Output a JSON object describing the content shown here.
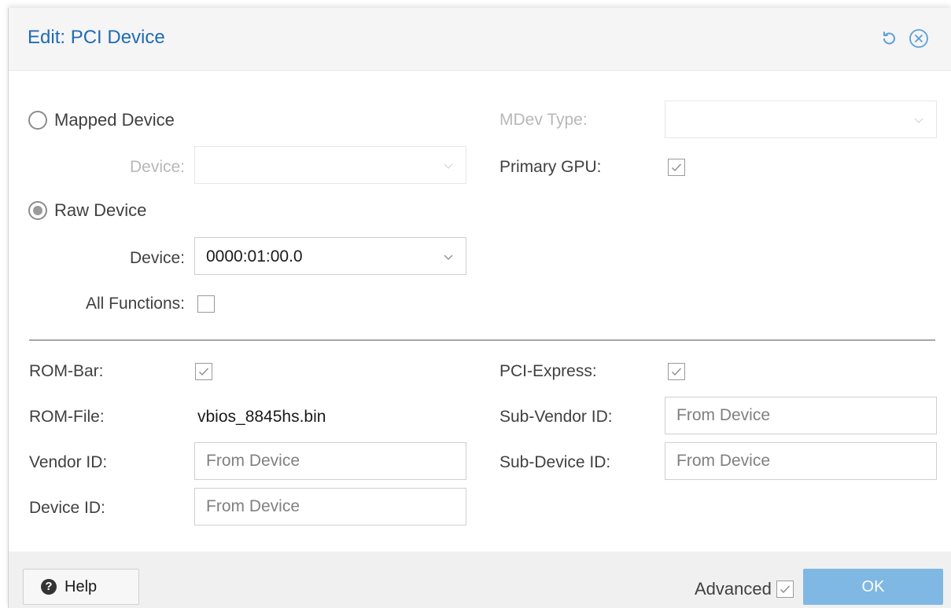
{
  "dialog": {
    "title": "Edit: PCI Device"
  },
  "mapped": {
    "radio_label": "Mapped Device",
    "selected": false,
    "device_label": "Device:",
    "device_value": ""
  },
  "raw": {
    "radio_label": "Raw Device",
    "selected": true,
    "device_label": "Device:",
    "device_value": "0000:01:00.0",
    "all_functions_label": "All Functions:",
    "all_functions_checked": false
  },
  "mdev": {
    "label": "MDev Type:",
    "value": ""
  },
  "primary_gpu": {
    "label": "Primary GPU:",
    "checked": true
  },
  "advanced": {
    "rom_bar_label": "ROM-Bar:",
    "rom_bar_checked": true,
    "rom_file_label": "ROM-File:",
    "rom_file_value": "vbios_8845hs.bin",
    "vendor_id_label": "Vendor ID:",
    "vendor_id_placeholder": "From Device",
    "device_id_label": "Device ID:",
    "device_id_placeholder": "From Device",
    "pci_express_label": "PCI-Express:",
    "pci_express_checked": true,
    "sub_vendor_id_label": "Sub-Vendor ID:",
    "sub_vendor_id_placeholder": "From Device",
    "sub_device_id_label": "Sub-Device ID:",
    "sub_device_id_placeholder": "From Device"
  },
  "footer": {
    "help_label": "Help",
    "help_icon_glyph": "?",
    "advanced_label": "Advanced",
    "advanced_checked": true,
    "ok_label": "OK"
  },
  "colors": {
    "title": "#1f6bb5",
    "ok_button": "#80b8e4",
    "header_icon": "#5a9fd9"
  },
  "icons": {
    "reset": "reset-icon",
    "close": "close-icon",
    "dropdown": "chevron-down-icon",
    "checkmark": "checkmark-icon",
    "help": "help-icon"
  }
}
